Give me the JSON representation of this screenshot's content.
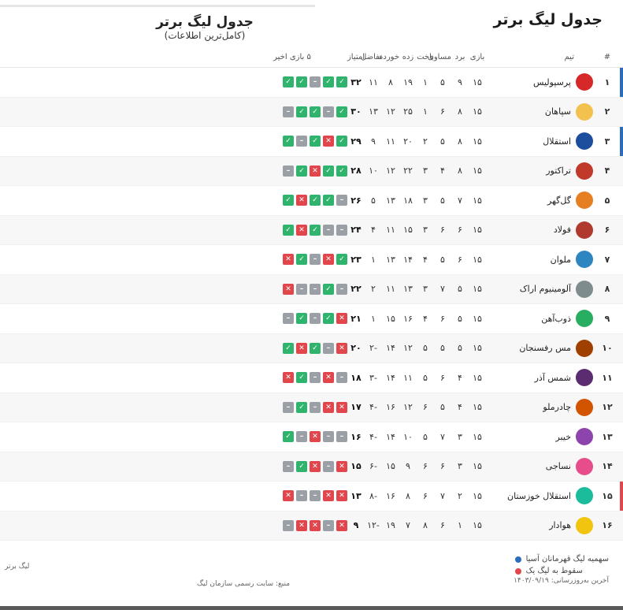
{
  "header": {
    "page_title": "جدول لیگ برتر",
    "league_title": "جدول لیگ برتر",
    "league_subtitle": "(کامل‌ترین اطلاعات)"
  },
  "columns": {
    "rank": "#",
    "team": "تیم",
    "played": "بازی",
    "won": "برد",
    "drawn": "مساوی",
    "lost": "باخت",
    "gf": "زده",
    "ga": "خورده",
    "gd": "تفاضل",
    "pts": "امتیاز",
    "form": "۵ بازی اخیر"
  },
  "rows": [
    {
      "rank": "۱",
      "team": "پرسپولیس",
      "crest_color": "#d62828",
      "played": "۱۵",
      "won": "۹",
      "drawn": "۵",
      "lost": "۱",
      "gf": "۱۹",
      "ga": "۸",
      "gd": "۱۱",
      "pts": "۳۲",
      "form": [
        "w",
        "w",
        "d",
        "w",
        "w"
      ]
    },
    {
      "rank": "۲",
      "team": "سپاهان",
      "crest_color": "#f2c14e",
      "played": "۱۵",
      "won": "۸",
      "drawn": "۶",
      "lost": "۱",
      "gf": "۲۵",
      "ga": "۱۲",
      "gd": "۱۳",
      "pts": "۳۰",
      "form": [
        "w",
        "d",
        "w",
        "w",
        "d"
      ]
    },
    {
      "rank": "۳",
      "team": "استقلال",
      "crest_color": "#1d4e9e",
      "played": "۱۵",
      "won": "۸",
      "drawn": "۵",
      "lost": "۲",
      "gf": "۲۰",
      "ga": "۱۱",
      "gd": "۹",
      "pts": "۲۹",
      "form": [
        "w",
        "l",
        "w",
        "d",
        "w"
      ]
    },
    {
      "rank": "۴",
      "team": "تراکتور",
      "crest_color": "#c0392b",
      "played": "۱۵",
      "won": "۸",
      "drawn": "۴",
      "lost": "۳",
      "gf": "۲۲",
      "ga": "۱۲",
      "gd": "۱۰",
      "pts": "۲۸",
      "form": [
        "w",
        "w",
        "l",
        "w",
        "d"
      ]
    },
    {
      "rank": "۵",
      "team": "گل‌گهر",
      "crest_color": "#e67e22",
      "played": "۱۵",
      "won": "۷",
      "drawn": "۵",
      "lost": "۳",
      "gf": "۱۸",
      "ga": "۱۳",
      "gd": "۵",
      "pts": "۲۶",
      "form": [
        "d",
        "w",
        "w",
        "l",
        "w"
      ]
    },
    {
      "rank": "۶",
      "team": "فولاد",
      "crest_color": "#b03a2e",
      "played": "۱۵",
      "won": "۶",
      "drawn": "۶",
      "lost": "۳",
      "gf": "۱۵",
      "ga": "۱۱",
      "gd": "۴",
      "pts": "۲۴",
      "form": [
        "d",
        "d",
        "w",
        "l",
        "w"
      ]
    },
    {
      "rank": "۷",
      "team": "ملوان",
      "crest_color": "#2e86c1",
      "played": "۱۵",
      "won": "۶",
      "drawn": "۵",
      "lost": "۴",
      "gf": "۱۴",
      "ga": "۱۳",
      "gd": "۱",
      "pts": "۲۳",
      "form": [
        "w",
        "l",
        "d",
        "w",
        "l"
      ]
    },
    {
      "rank": "۸",
      "team": "آلومینیوم اراک",
      "crest_color": "#7f8c8d",
      "played": "۱۵",
      "won": "۵",
      "drawn": "۷",
      "lost": "۳",
      "gf": "۱۳",
      "ga": "۱۱",
      "gd": "۲",
      "pts": "۲۲",
      "form": [
        "d",
        "w",
        "d",
        "d",
        "l"
      ]
    },
    {
      "rank": "۹",
      "team": "ذوب‌آهن",
      "crest_color": "#27ae60",
      "played": "۱۵",
      "won": "۵",
      "drawn": "۶",
      "lost": "۴",
      "gf": "۱۶",
      "ga": "۱۵",
      "gd": "۱",
      "pts": "۲۱",
      "form": [
        "l",
        "w",
        "d",
        "w",
        "d"
      ]
    },
    {
      "rank": "۱۰",
      "team": "مس رفسنجان",
      "crest_color": "#a04000",
      "played": "۱۵",
      "won": "۵",
      "drawn": "۵",
      "lost": "۵",
      "gf": "۱۲",
      "ga": "۱۴",
      "gd": "-۲",
      "pts": "۲۰",
      "form": [
        "l",
        "d",
        "w",
        "l",
        "w"
      ]
    },
    {
      "rank": "۱۱",
      "team": "شمس آذر",
      "crest_color": "#5b2c6f",
      "played": "۱۵",
      "won": "۴",
      "drawn": "۶",
      "lost": "۵",
      "gf": "۱۱",
      "ga": "۱۴",
      "gd": "-۳",
      "pts": "۱۸",
      "form": [
        "d",
        "l",
        "d",
        "w",
        "l"
      ]
    },
    {
      "rank": "۱۲",
      "team": "چادرملو",
      "crest_color": "#d35400",
      "played": "۱۵",
      "won": "۴",
      "drawn": "۵",
      "lost": "۶",
      "gf": "۱۲",
      "ga": "۱۶",
      "gd": "-۴",
      "pts": "۱۷",
      "form": [
        "l",
        "l",
        "d",
        "w",
        "d"
      ]
    },
    {
      "rank": "۱۳",
      "team": "خیبر",
      "crest_color": "#8e44ad",
      "played": "۱۵",
      "won": "۳",
      "drawn": "۷",
      "lost": "۵",
      "gf": "۱۰",
      "ga": "۱۴",
      "gd": "-۴",
      "pts": "۱۶",
      "form": [
        "d",
        "d",
        "l",
        "d",
        "w"
      ]
    },
    {
      "rank": "۱۴",
      "team": "نساجی",
      "crest_color": "#e74c8b",
      "played": "۱۵",
      "won": "۳",
      "drawn": "۶",
      "lost": "۶",
      "gf": "۹",
      "ga": "۱۵",
      "gd": "-۶",
      "pts": "۱۵",
      "form": [
        "l",
        "d",
        "l",
        "w",
        "d"
      ]
    },
    {
      "rank": "۱۵",
      "team": "استقلال خوزستان",
      "crest_color": "#1abc9c",
      "played": "۱۵",
      "won": "۲",
      "drawn": "۷",
      "lost": "۶",
      "gf": "۸",
      "ga": "۱۶",
      "gd": "-۸",
      "pts": "۱۳",
      "form": [
        "l",
        "l",
        "d",
        "d",
        "l"
      ]
    },
    {
      "rank": "۱۶",
      "team": "هوادار",
      "crest_color": "#f1c40f",
      "played": "۱۵",
      "won": "۱",
      "drawn": "۶",
      "lost": "۸",
      "gf": "۷",
      "ga": "۱۹",
      "gd": "-۱۲",
      "pts": "۹",
      "form": [
        "l",
        "d",
        "l",
        "l",
        "d"
      ]
    }
  ],
  "footer": {
    "legend_ucl": "سهمیه لیگ قهرمانان آسیا",
    "legend_rel": "سقوط به لیگ یک",
    "update_note": "آخرین به‌روزرسانی: ۱۴۰۳/۰۹/۱۹",
    "source_note": "منبع: سایت رسمی سازمان لیگ",
    "left_note": "لیگ برتر"
  },
  "colors": {
    "win": "#2fb36d",
    "loss": "#e0464b",
    "draw": "#9aa0a6",
    "ucl_zone": "#2a6ebb",
    "uel_zone": "#f08a24",
    "rel_zone": "#e0464b",
    "accent": "#c9a227"
  }
}
